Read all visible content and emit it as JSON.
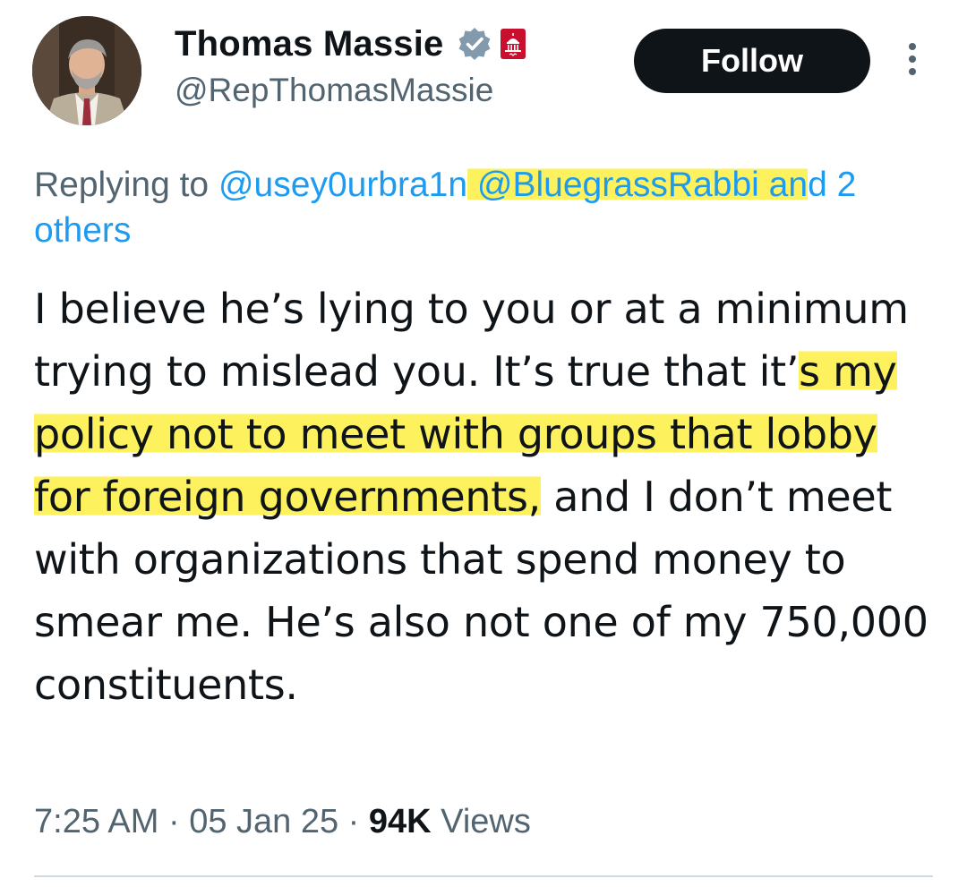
{
  "author": {
    "display_name": "Thomas Massie",
    "handle": "@RepThomasMassie",
    "verified": true,
    "affiliation_badge": "us-capitol-seal"
  },
  "actions": {
    "follow_label": "Follow",
    "more_icon": "more-vertical-icon"
  },
  "reply": {
    "prefix": "Replying to",
    "mention_1": "@usey0urbra1n",
    "mention_2": "@BluegrassRabbi",
    "suffix_a": "an",
    "suffix_b": "d 2",
    "suffix_line2": "others"
  },
  "tweet": {
    "part1": "I believe he’s lying to you or at a minimum trying to mislead you. It’s true that it’",
    "part2_highlight": "s my policy not to meet with groups that lobby for foreign governments,",
    "part3": " and I don’t meet with organizations that spend money to smear me. He’s also not one of my 750,000 constituents."
  },
  "meta": {
    "time": "7:25 AM",
    "separator": " · ",
    "date": "05 Jan 25",
    "views_count": "94K",
    "views_label": " Views"
  },
  "colors": {
    "link": "#1d9bf0",
    "secondary_text": "#536471",
    "primary_text": "#0f1419",
    "follow_bg": "#0f1419",
    "highlight": "#fdf25d",
    "divider": "#cfd9de"
  }
}
